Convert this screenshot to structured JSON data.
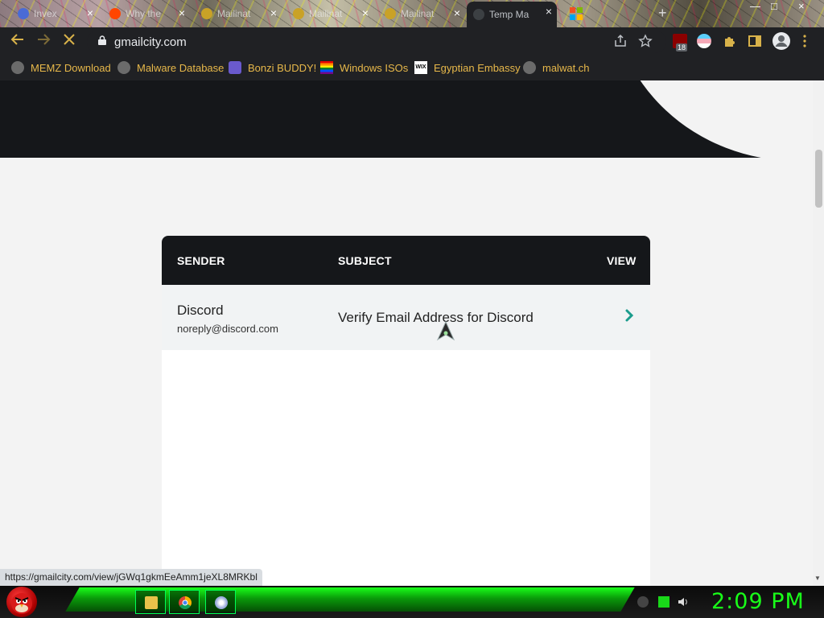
{
  "browser": {
    "tabs": [
      {
        "title": "Invex",
        "close": "×"
      },
      {
        "title": "Why the",
        "close": "×"
      },
      {
        "title": "Mailinat",
        "close": "×"
      },
      {
        "title": "Mailinat",
        "close": "×"
      },
      {
        "title": "Mailinat",
        "close": "×"
      },
      {
        "title": "Temp Ma",
        "close": "×"
      }
    ],
    "new_tab": "+",
    "url": "gmailcity.com",
    "extension_badge": "18",
    "window_controls": {
      "minimize": "—",
      "maximize": "□",
      "close": "×"
    }
  },
  "bookmarks": [
    {
      "label": "MEMZ Download",
      "icon": "globe-icon"
    },
    {
      "label": "Malware Database",
      "icon": "globe-icon"
    },
    {
      "label": "Bonzi BUDDY!",
      "icon": "bonzi-icon"
    },
    {
      "label": "Windows ISOs",
      "icon": "rainbow-icon"
    },
    {
      "label": "Egyptian Embassy",
      "icon": "wix-icon"
    },
    {
      "label": "malwat.ch",
      "icon": "globe-icon"
    }
  ],
  "inbox": {
    "headers": {
      "sender": "SENDER",
      "subject": "SUBJECT",
      "view": "VIEW"
    },
    "messages": [
      {
        "sender_name": "Discord",
        "sender_email": "noreply@discord.com",
        "subject": "Verify Email Address for Discord"
      }
    ]
  },
  "status_url": "https://gmailcity.com/view/jGWq1gkmEeAmm1jeXL8MRKbl",
  "taskbar": {
    "clock": "2:09 PM"
  },
  "colors": {
    "accent_arrow": "#1a9c8c",
    "hero_dark": "#15171a",
    "clock_green": "#19ff19",
    "bookmark_text": "#e7b84a"
  }
}
